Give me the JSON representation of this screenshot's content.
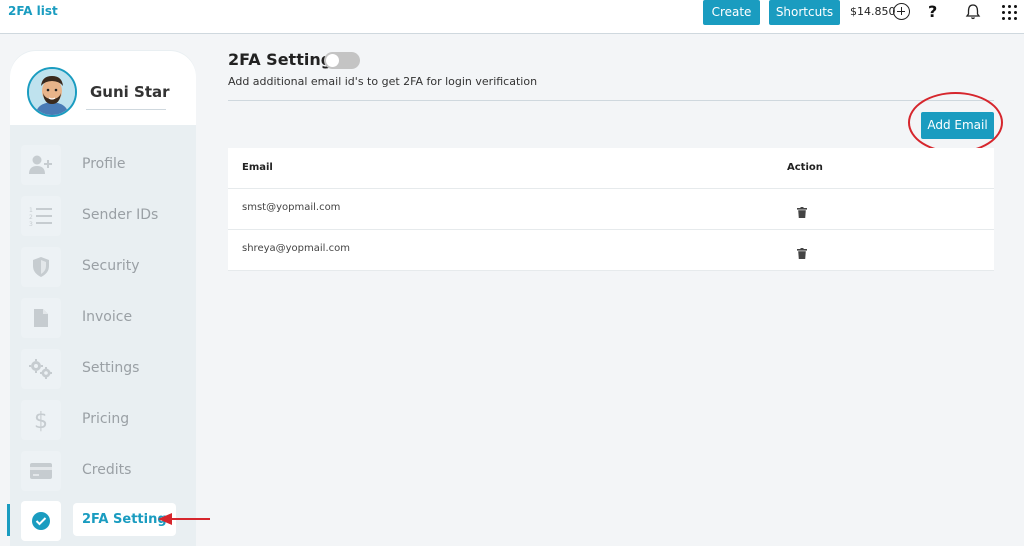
{
  "header": {
    "page_title": "2FA list",
    "create_label": "Create",
    "shortcuts_label": "Shortcuts",
    "balance": "$14.850",
    "help_label": "?",
    "accent_color": "#1a9cc0"
  },
  "sidebar": {
    "user_name": "Guni Star",
    "items": [
      {
        "label": "Profile",
        "icon": "add-user-icon"
      },
      {
        "label": "Sender IDs",
        "icon": "numbered-list-icon"
      },
      {
        "label": "Security",
        "icon": "shield-icon"
      },
      {
        "label": "Invoice",
        "icon": "document-icon"
      },
      {
        "label": "Settings",
        "icon": "gears-icon"
      },
      {
        "label": "Pricing",
        "icon": "dollar-icon"
      },
      {
        "label": "Credits",
        "icon": "credit-card-icon"
      },
      {
        "label": "2FA Setting",
        "icon": "check-circle-icon",
        "active": true
      }
    ]
  },
  "main": {
    "title": "2FA Setting",
    "toggle_on": false,
    "description": "Add additional email id's to get 2FA for login verification",
    "add_email_label": "Add Email",
    "table": {
      "columns": [
        "Email",
        "Action"
      ],
      "rows": [
        {
          "email": "smst@yopmail.com",
          "action_icon": "trash-icon"
        },
        {
          "email": "shreya@yopmail.com",
          "action_icon": "trash-icon"
        }
      ]
    }
  }
}
